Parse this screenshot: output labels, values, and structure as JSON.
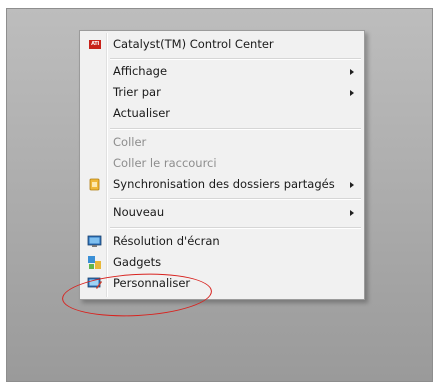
{
  "context_menu": {
    "items": [
      {
        "label": "Catalyst(TM) Control Center",
        "icon": "ati-logo-icon",
        "enabled": true,
        "submenu": false
      },
      {
        "label": "Affichage",
        "enabled": true,
        "submenu": true
      },
      {
        "label": "Trier par",
        "enabled": true,
        "submenu": true
      },
      {
        "label": "Actualiser",
        "enabled": true,
        "submenu": false
      },
      {
        "label": "Coller",
        "enabled": false,
        "submenu": false
      },
      {
        "label": "Coller le raccourci",
        "enabled": false,
        "submenu": false
      },
      {
        "label": "Synchronisation des dossiers partagés",
        "icon": "sync-folder-icon",
        "enabled": true,
        "submenu": true
      },
      {
        "label": "Nouveau",
        "enabled": true,
        "submenu": true
      },
      {
        "label": "Résolution d'écran",
        "icon": "monitor-icon",
        "enabled": true,
        "submenu": false
      },
      {
        "label": "Gadgets",
        "icon": "gadgets-icon",
        "enabled": true,
        "submenu": false
      },
      {
        "label": "Personnaliser",
        "icon": "personalize-icon",
        "enabled": true,
        "submenu": false
      }
    ],
    "ati_logo_text": "ATI"
  },
  "annotation": {
    "shape": "ellipse",
    "color": "#d8231f",
    "highlights": "Personnaliser"
  }
}
